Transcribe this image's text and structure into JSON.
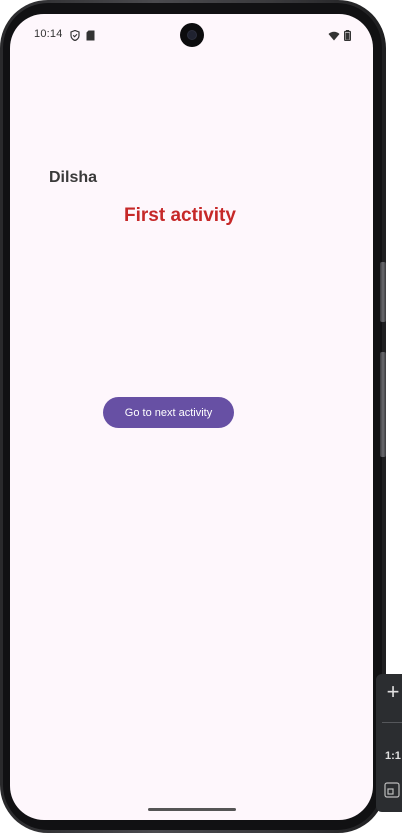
{
  "status_bar": {
    "time": "10:14",
    "left_icons": [
      "shield-icon",
      "sd-card-icon"
    ],
    "right_icons": [
      "wifi-icon",
      "battery-icon"
    ]
  },
  "app": {
    "name_label": "Dilsha",
    "title": "First activity",
    "next_button_label": "Go to next activity"
  },
  "emulator_toolbar": {
    "zoom_in_icon": "plus-icon",
    "ratio_label": "1:1",
    "frame_icon": "resize-frame-icon"
  },
  "colors": {
    "screen_background": "#fef7fc",
    "title_color": "#c62828",
    "button_background": "#6750a4",
    "name_color": "#3a3a3a"
  }
}
